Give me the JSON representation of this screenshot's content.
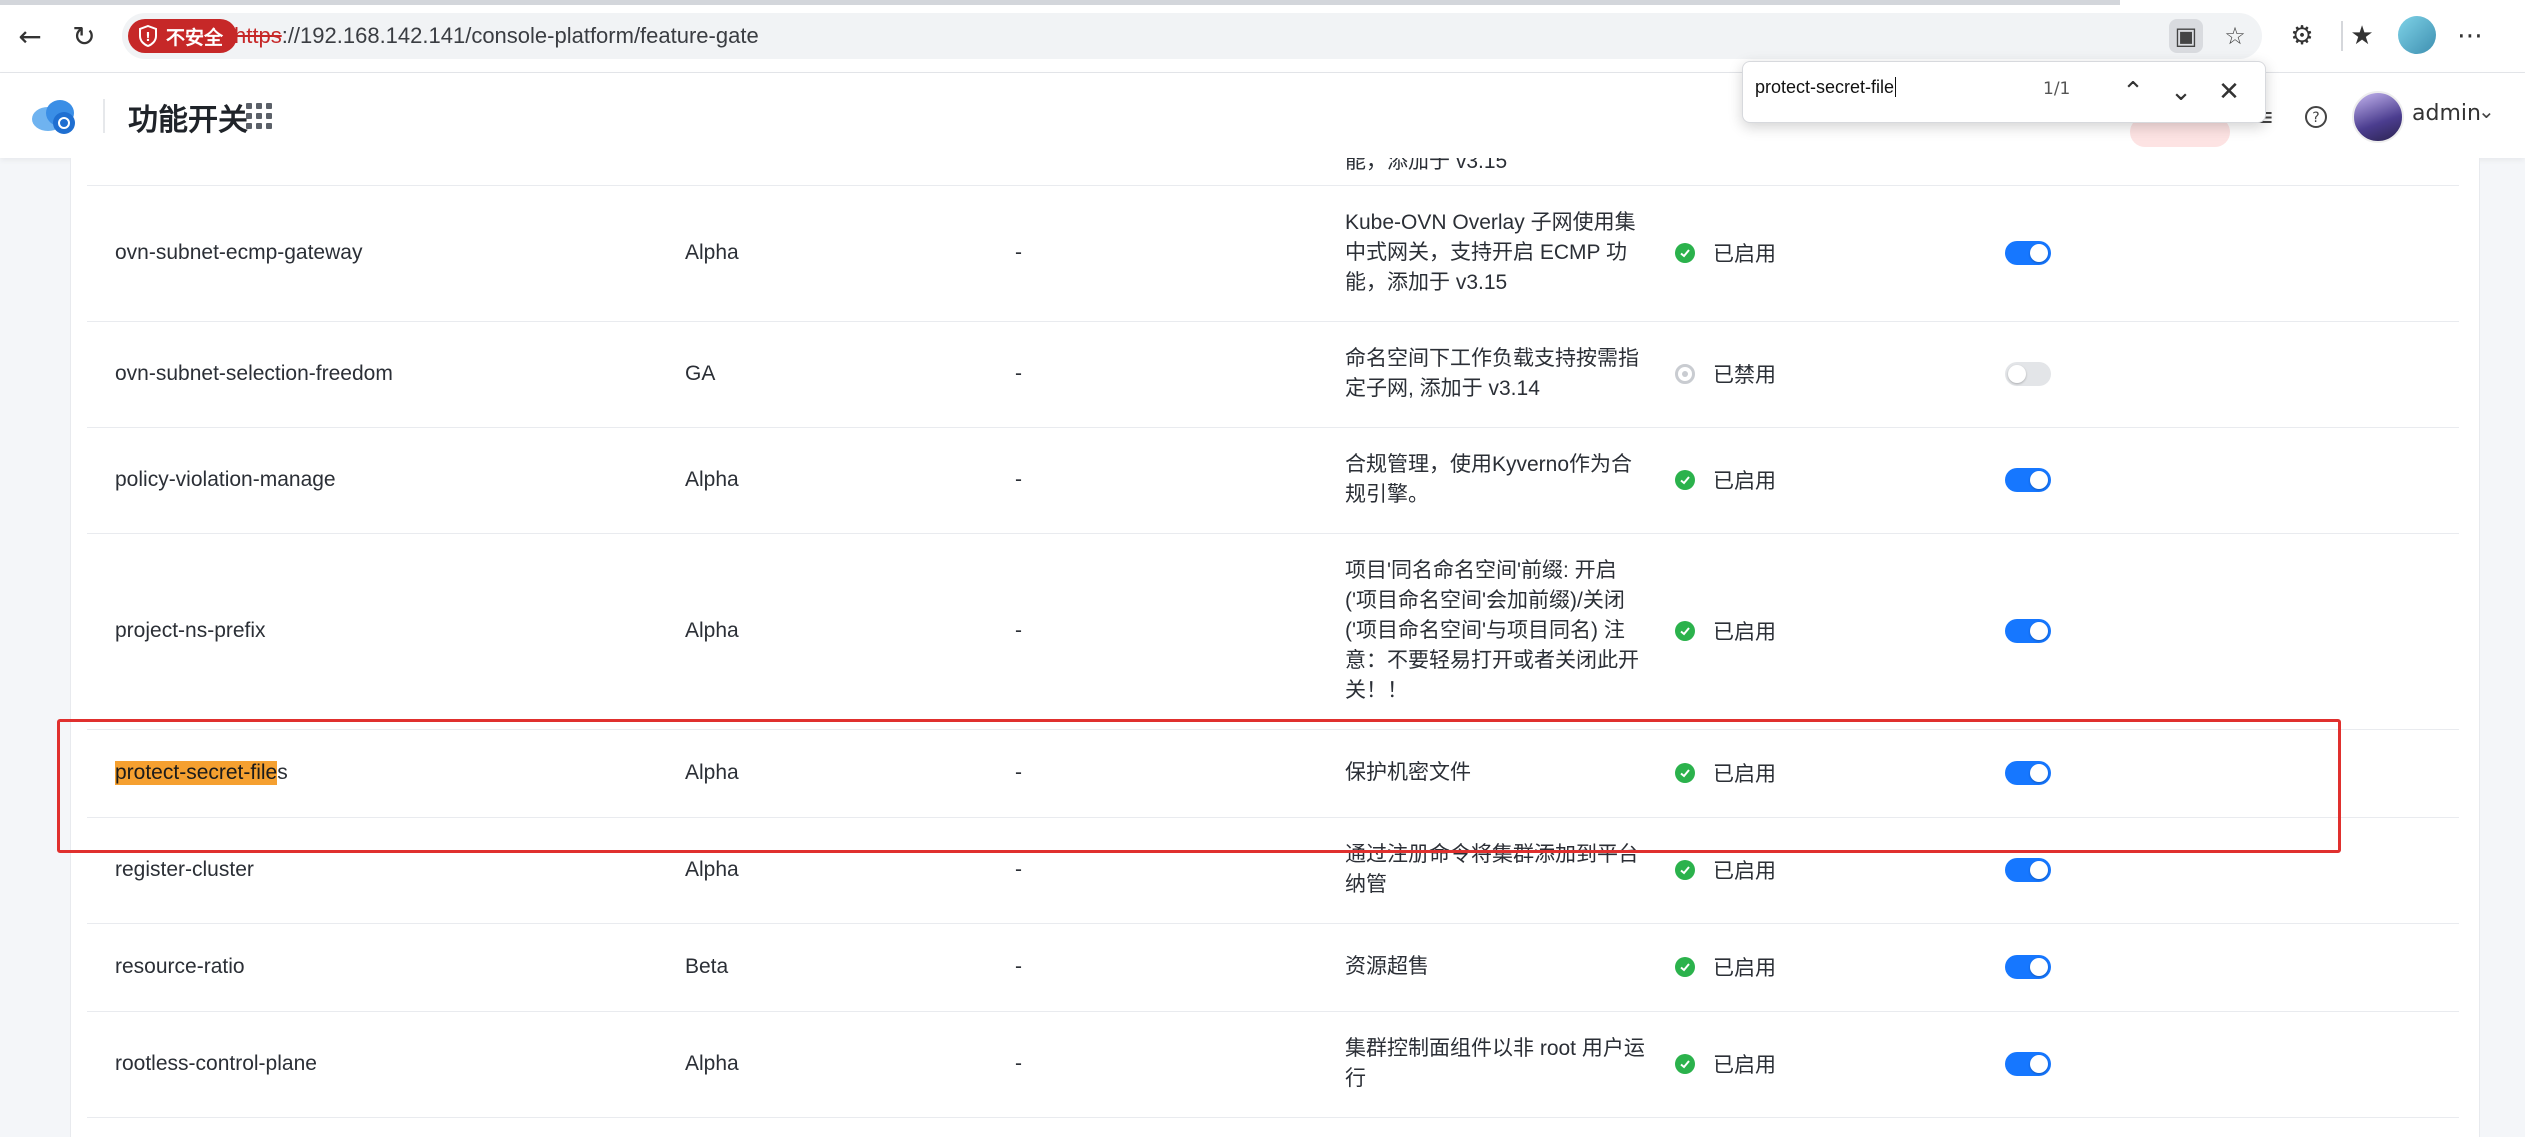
{
  "browser": {
    "insecure_label": "不安全",
    "url_scheme": "https",
    "url_rest": "://192.168.142.141/console-platform/feature-gate"
  },
  "header": {
    "title": "功能开关",
    "user_name": "admin"
  },
  "find_bar": {
    "query": "protect-secret-file",
    "count": "1/1"
  },
  "colors": {
    "accent": "#1677ff",
    "enabled": "#2bb24c",
    "insecure": "#c62828",
    "find_highlight": "#f5a030",
    "annotation_box": "#e0302e"
  },
  "table": {
    "partial_top_desc": "能，添加于 v3.15",
    "rows": [
      {
        "name": "ovn-subnet-ecmp-gateway",
        "stage": "Alpha",
        "dependency": "-",
        "description": "Kube-OVN Overlay 子网使用集中式网关，支持开启 ECMP 功能，添加于 v3.15",
        "status": "已启用",
        "enabled": true
      },
      {
        "name": "ovn-subnet-selection-freedom",
        "stage": "GA",
        "dependency": "-",
        "description": "命名空间下工作负载支持按需指定子网, 添加于 v3.14",
        "status": "已禁用",
        "enabled": false
      },
      {
        "name": "policy-violation-manage",
        "stage": "Alpha",
        "dependency": "-",
        "description": "合规管理，使用Kyverno作为合规引擎。",
        "status": "已启用",
        "enabled": true
      },
      {
        "name": "project-ns-prefix",
        "stage": "Alpha",
        "dependency": "-",
        "description": "项目'同名命名空间'前缀: 开启('项目命名空间'会加前缀)/关闭('项目命名空间'与项目同名) 注意：不要轻易打开或者关闭此开关！！",
        "status": "已启用",
        "enabled": true
      },
      {
        "name_match": "protect-secret-file",
        "name_rest": "s",
        "stage": "Alpha",
        "dependency": "-",
        "description": "保护机密文件",
        "status": "已启用",
        "enabled": true
      },
      {
        "name": "register-cluster",
        "stage": "Alpha",
        "dependency": "-",
        "description": "通过注册命令将集群添加到平台纳管",
        "status": "已启用",
        "enabled": true
      },
      {
        "name": "resource-ratio",
        "stage": "Beta",
        "dependency": "-",
        "description": "资源超售",
        "status": "已启用",
        "enabled": true
      },
      {
        "name": "rootless-control-plane",
        "stage": "Alpha",
        "dependency": "-",
        "description": "集群控制面组件以非 root 用户运行",
        "status": "已启用",
        "enabled": true
      }
    ]
  }
}
